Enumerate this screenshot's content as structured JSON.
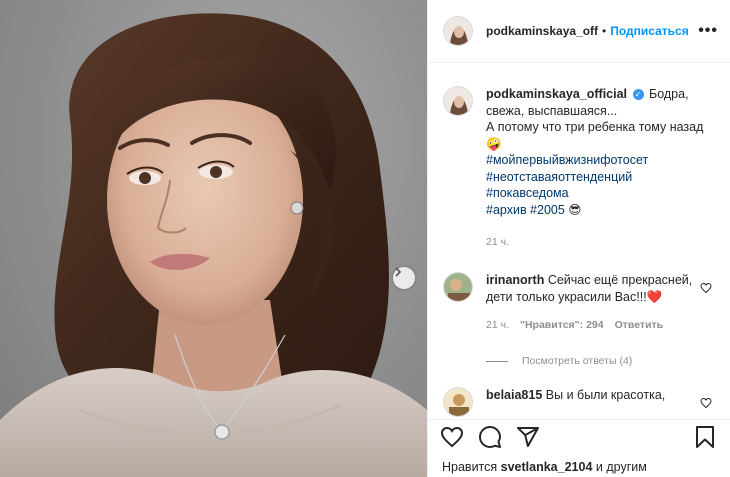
{
  "post": {
    "username": "podkaminskaya_official",
    "header_username": "podkaminskaya_off",
    "dot": "•",
    "follow_label": "Подписаться",
    "more_label": "•••"
  },
  "caption": {
    "username": "podkaminskaya_official",
    "text_1": "Бодра, свежа, выспавшаяся...",
    "text_2": "А потому что три ребенка тому назад",
    "emoji_1": "🤪",
    "hashtags": [
      "#мойпервыйвжизнифотосет",
      "#неотставаяоттенденций",
      "#покавседома"
    ],
    "last_line_tags": "#архив #2005",
    "emoji_2": "😎",
    "time": "21 ч."
  },
  "comments": [
    {
      "username": "irinanorth",
      "text": "Сейчас ещё прекрасней, дети только украсили Вас!!!",
      "emoji": "❤️",
      "time": "21 ч.",
      "likes": "\"Нравится\": 294",
      "reply_label": "Ответить",
      "view_replies": "Посмотреть ответы (4)"
    },
    {
      "username": "belaia815",
      "text": "Вы и были красотка,"
    }
  ],
  "likes": {
    "prefix": "Нравится",
    "user": "svetlanka_2104",
    "suffix": "и другим"
  },
  "icons": [
    "heart-icon",
    "comment-icon",
    "share-icon",
    "bookmark-icon",
    "chevron-right-icon",
    "verified-icon"
  ],
  "colors": {
    "accent": "#0095f6",
    "verified": "#3897f0",
    "hashtag": "#00376b",
    "muted": "#8e8e8e"
  }
}
